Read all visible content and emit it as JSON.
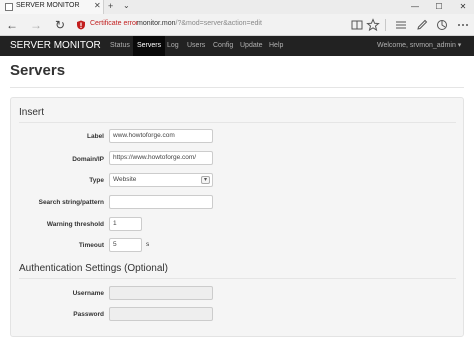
{
  "browser": {
    "tab_title": "SERVER MONITOR",
    "tab_close": "✕",
    "new_tab": "+",
    "tab_dropdown": "⌄",
    "cert_error": "Certificate error",
    "url_host": "monitor.mon",
    "url_path": "/?&mod=server&action=edit",
    "buttons": {
      "minimize": "—",
      "maximize": "☐",
      "close": "✕",
      "back": "←",
      "forward": "→",
      "refresh": "↻"
    }
  },
  "app": {
    "brand": "SERVER MONITOR",
    "nav": [
      "Status",
      "Servers",
      "Log",
      "Users",
      "Config",
      "Update",
      "Help"
    ],
    "active_nav": "Servers",
    "welcome": "Welcome, srvmon_admin ▾"
  },
  "page": {
    "title": "Servers",
    "insert_legend": "Insert",
    "fields": {
      "label": {
        "label": "Label",
        "value": "www.howtoforge.com"
      },
      "domain": {
        "label": "Domain/IP",
        "value": "https://www.howtoforge.com/"
      },
      "type": {
        "label": "Type",
        "value": "Website"
      },
      "search": {
        "label": "Search string/pattern",
        "value": ""
      },
      "warning": {
        "label": "Warning threshold",
        "value": "1"
      },
      "timeout": {
        "label": "Timeout",
        "value": "5",
        "unit": "s"
      }
    },
    "auth_legend": "Authentication Settings (Optional)",
    "auth": {
      "username": {
        "label": "Username",
        "value": ""
      },
      "password": {
        "label": "Password",
        "value": ""
      }
    }
  },
  "colors": {
    "header_bg": "#222222",
    "active_nav_bg": "#090909",
    "cert_error": "#c21f1f"
  }
}
